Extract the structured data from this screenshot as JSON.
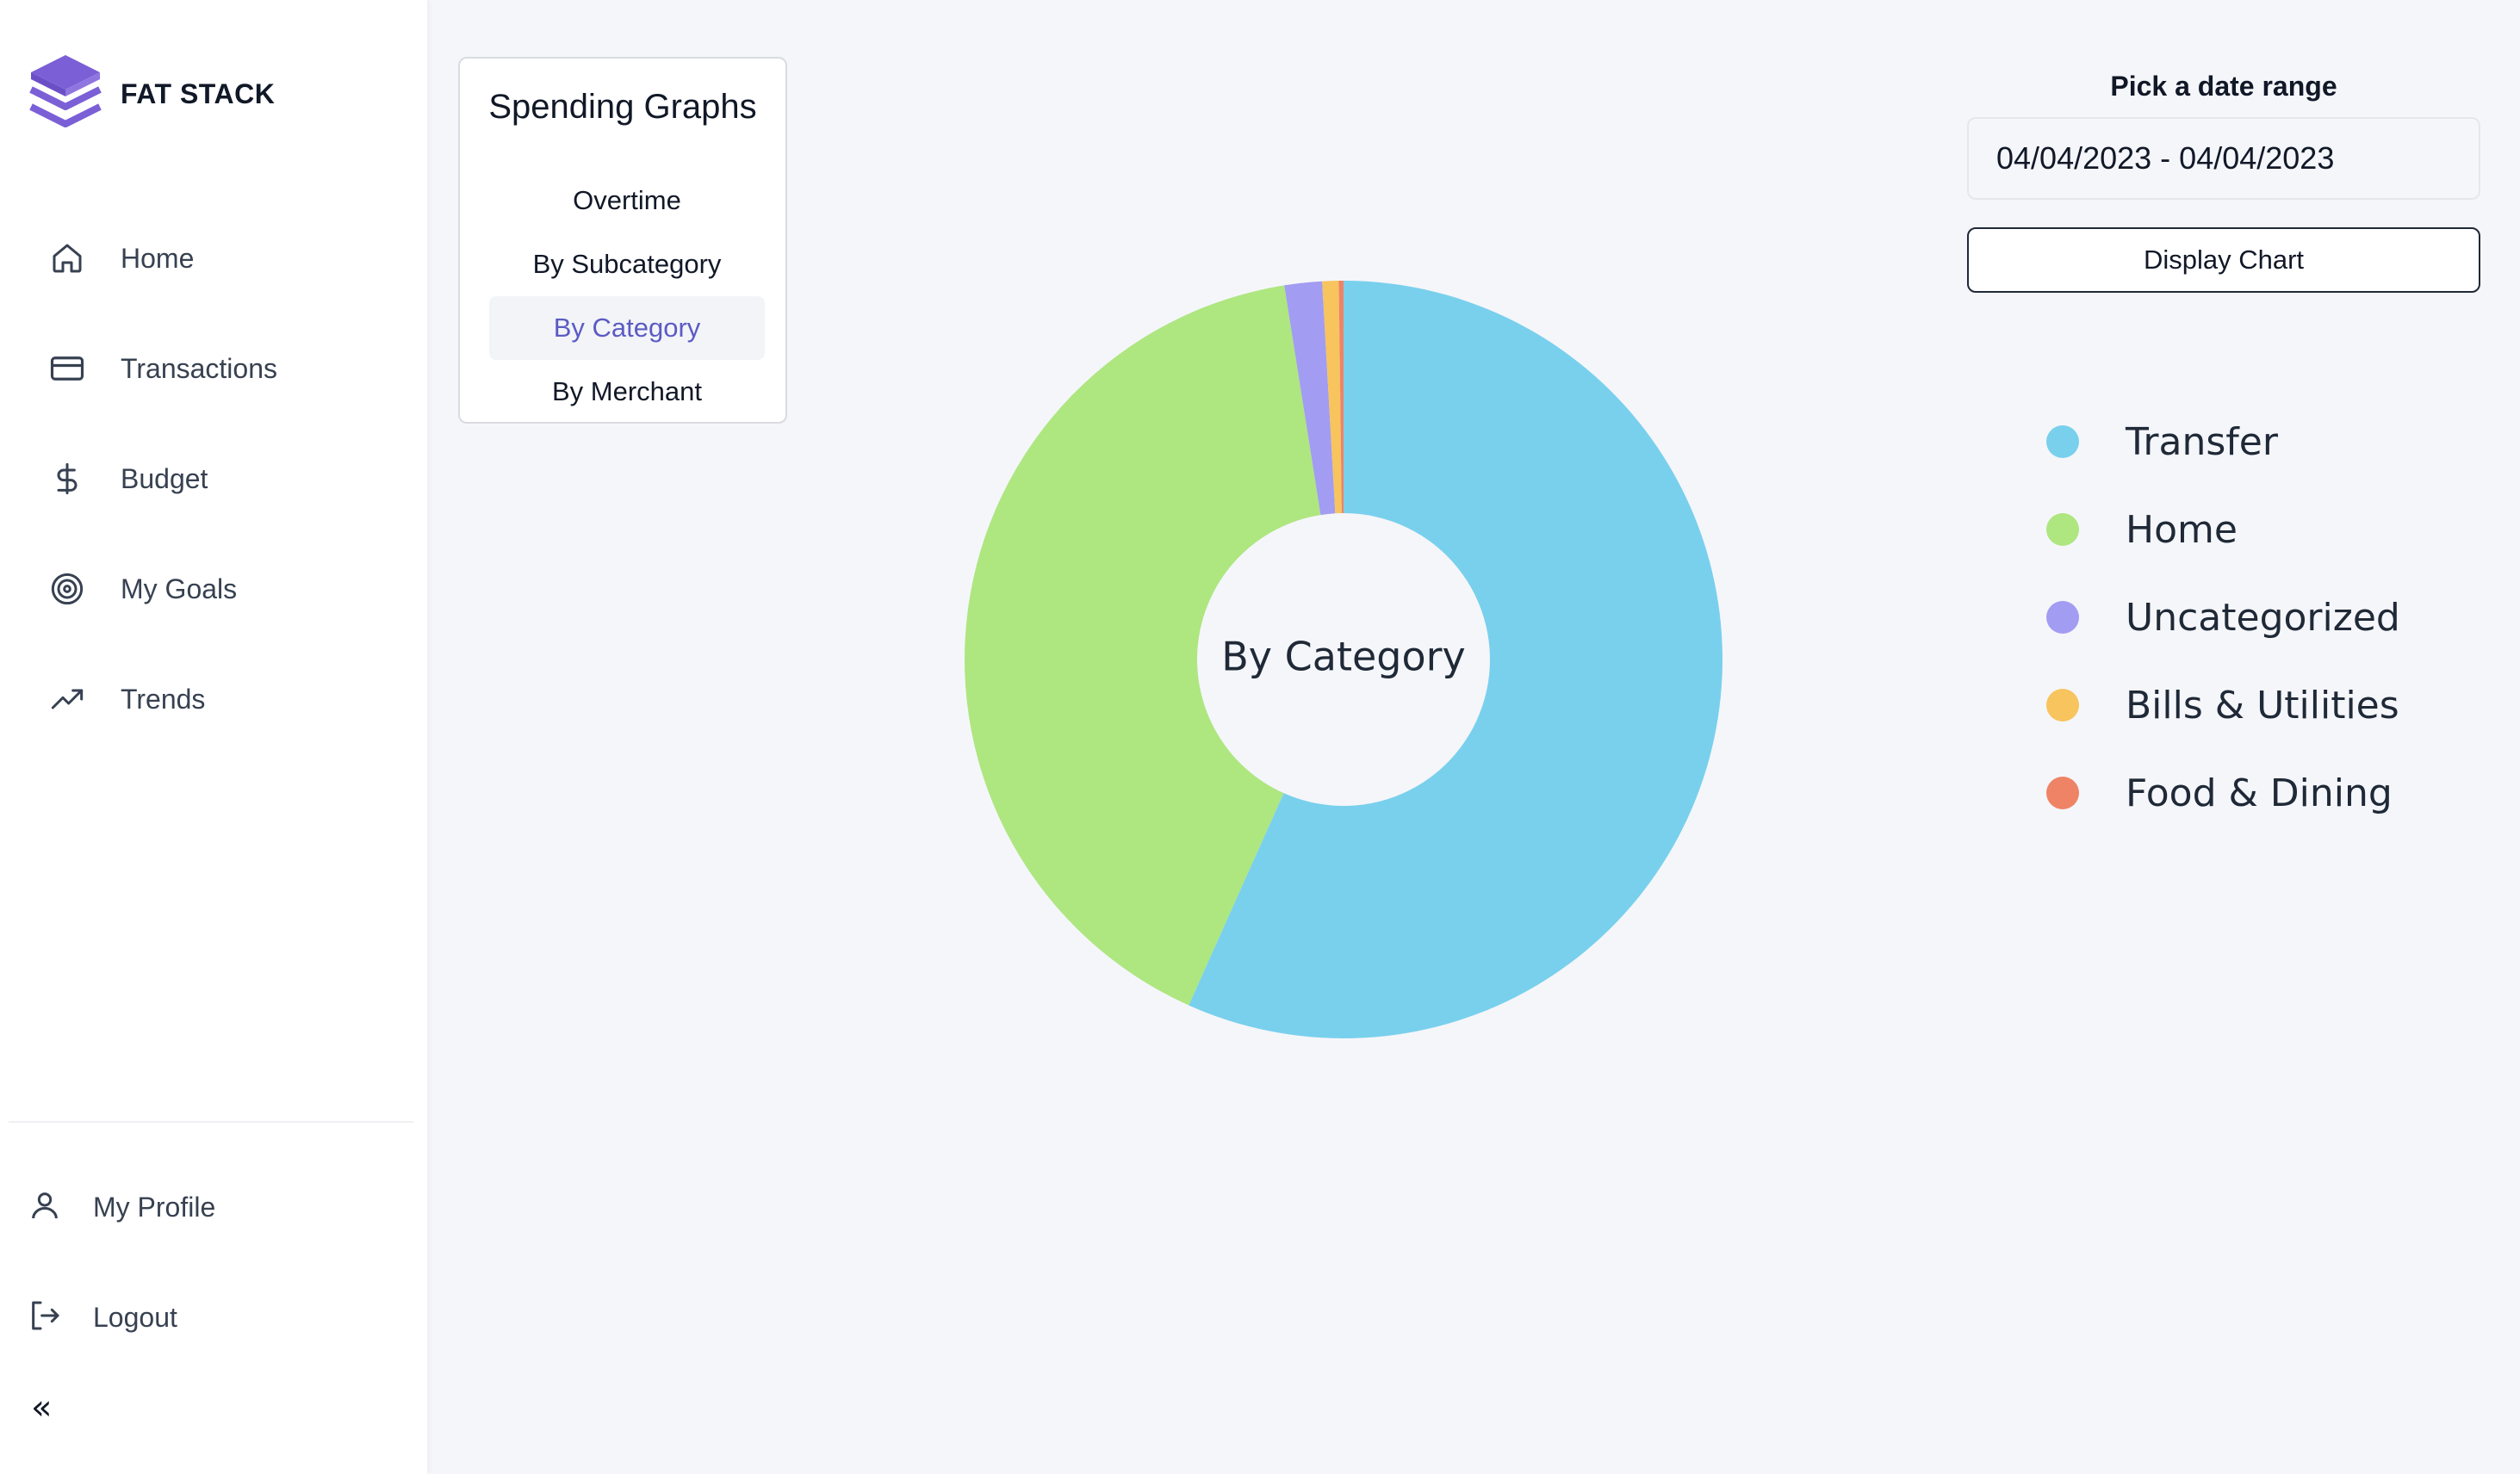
{
  "app": {
    "name": "FAT STACK"
  },
  "sidebar": {
    "items": [
      {
        "label": "Home",
        "icon": "home-icon"
      },
      {
        "label": "Transactions",
        "icon": "credit-card-icon"
      },
      {
        "label": "Budget",
        "icon": "dollar-icon"
      },
      {
        "label": "My Goals",
        "icon": "target-icon"
      },
      {
        "label": "Trends",
        "icon": "trending-up-icon"
      }
    ],
    "bottom_items": [
      {
        "label": "My Profile",
        "icon": "user-icon"
      },
      {
        "label": "Logout",
        "icon": "logout-icon"
      }
    ],
    "collapse_label": "«"
  },
  "graph_menu": {
    "title": "Spending Graphs",
    "options": [
      {
        "label": "Overtime",
        "active": false
      },
      {
        "label": "By Subcategory",
        "active": false
      },
      {
        "label": "By Category",
        "active": true
      },
      {
        "label": "By Merchant",
        "active": false
      }
    ]
  },
  "date_range": {
    "label": "Pick a date range",
    "value": "04/04/2023 - 04/04/2023",
    "button_label": "Display Chart"
  },
  "colors": {
    "accent": "#7b5fd6",
    "active_text": "#5b5bc4"
  },
  "chart_data": {
    "type": "pie",
    "center_label": "By Category",
    "categories": [
      "Transfer",
      "Home",
      "Uncategorized",
      "Bills & Utilities",
      "Food & Dining"
    ],
    "values": [
      56.7,
      40.8,
      1.6,
      0.7,
      0.2
    ],
    "colors": [
      "#79d0ed",
      "#aee680",
      "#a29cf2",
      "#f7c45e",
      "#ef8366"
    ],
    "legend_position": "right"
  }
}
